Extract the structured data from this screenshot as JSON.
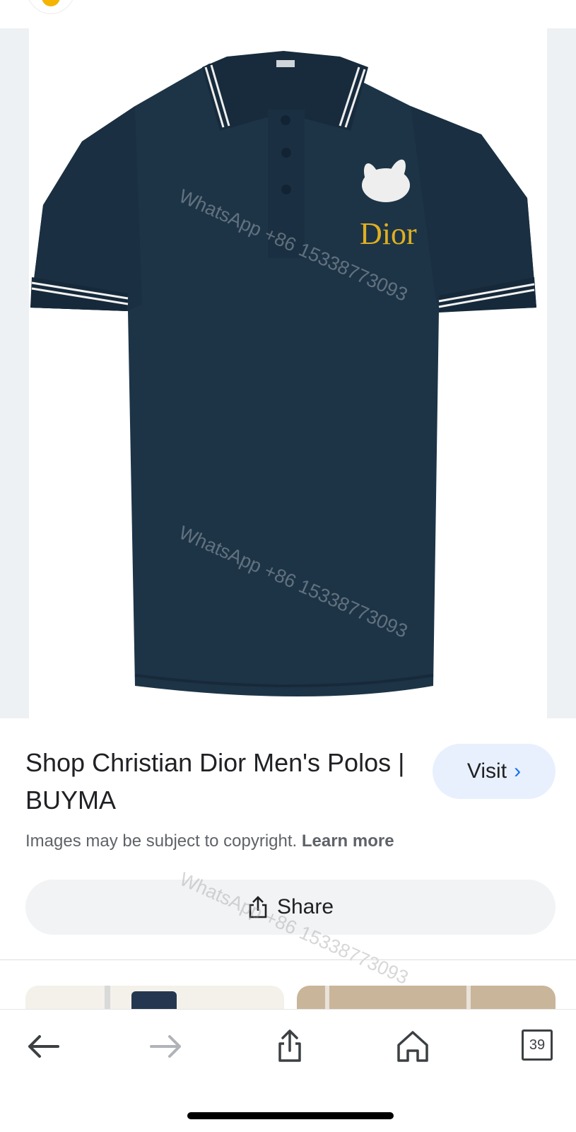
{
  "result": {
    "title": "Shop Christian Dior Men's Polos | BUYMA",
    "visit_label": "Visit",
    "copyright_text": "Images may be subject to copyright.",
    "learn_more_label": "Learn more",
    "share_label": "Share"
  },
  "image": {
    "watermark_text": "WhatsApp +86 15338773093",
    "logo_text": "Dior",
    "shirt_color": "#1d3447"
  },
  "bottom_bar": {
    "back_icon": "arrow-left",
    "forward_icon": "arrow-right",
    "share_icon": "share-up",
    "home_icon": "home",
    "tab_count": "39"
  },
  "colors": {
    "accent": "#1a73e8",
    "visit_bg": "#e8f0fe",
    "share_bg": "#f1f3f4"
  }
}
